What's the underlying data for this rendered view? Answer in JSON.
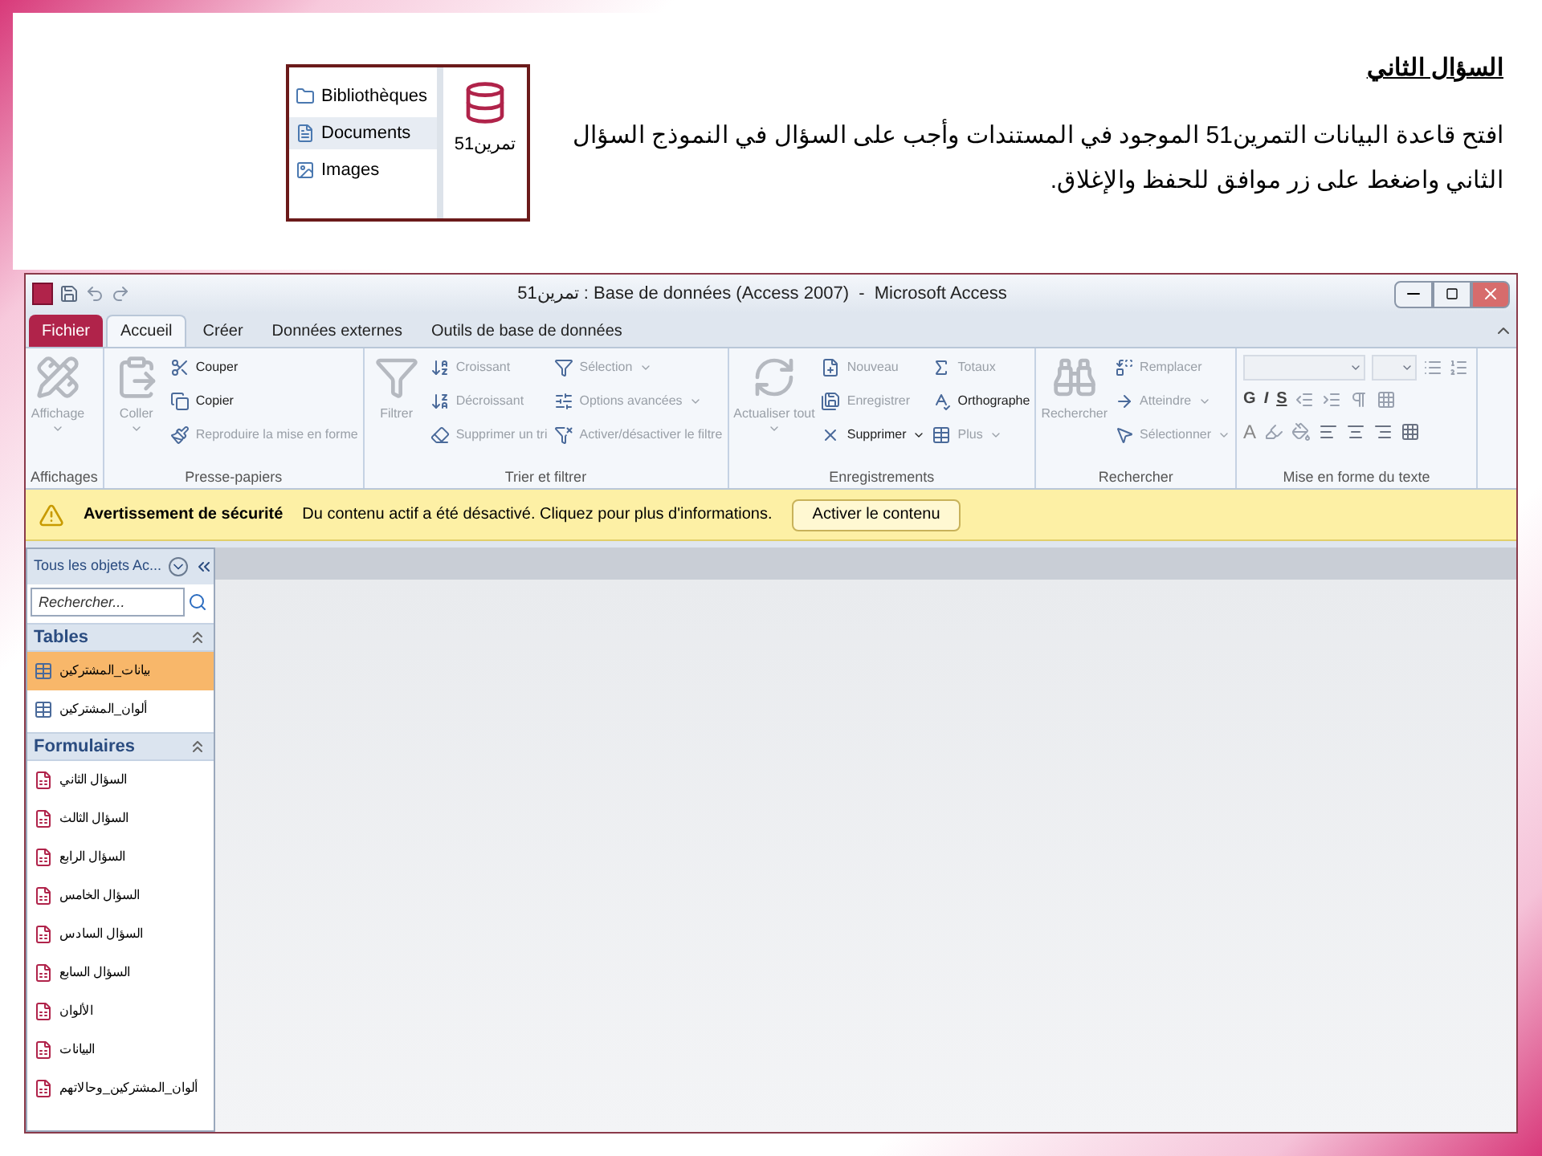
{
  "slide": {
    "heading": "السؤال الثاني",
    "instruction": "افتح قاعدة البيانات التمرين51 الموجود في  المستندات وأجب على السؤال في النموذج السؤال الثاني واضغط على زر موافق للحفظ والإغلاق.",
    "explorer": {
      "items": [
        {
          "label": "Bibliothèques",
          "kind": "library",
          "selected": false
        },
        {
          "label": "Documents",
          "kind": "document",
          "selected": true
        },
        {
          "label": "Images",
          "kind": "image",
          "selected": false
        }
      ],
      "file": "تمرين51"
    }
  },
  "window": {
    "title": "تمرين51 : Base de données (Access 2007)  -  Microsoft Access"
  },
  "tabs": [
    {
      "label": "Fichier",
      "kind": "file",
      "selected": false
    },
    {
      "label": "Accueil",
      "kind": "tab",
      "selected": true
    },
    {
      "label": "Créer",
      "kind": "tab",
      "selected": false
    },
    {
      "label": "Données externes",
      "kind": "tab",
      "selected": false
    },
    {
      "label": "Outils de base de données",
      "kind": "tab",
      "selected": false
    }
  ],
  "ribbon": {
    "groups": [
      {
        "label": "Affichages",
        "items": [
          {
            "label": "Affichage",
            "kind": "large",
            "disabled": true,
            "dropdown": true
          }
        ]
      },
      {
        "label": "Presse-papiers",
        "items": [
          {
            "label": "Coller",
            "kind": "large",
            "disabled": true,
            "dropdown": true
          },
          {
            "label": "Couper",
            "kind": "small",
            "disabled": false,
            "dropdown": false
          },
          {
            "label": "Copier",
            "kind": "small",
            "disabled": false,
            "dropdown": false
          },
          {
            "label": "Reproduire la mise en forme",
            "kind": "small",
            "disabled": true,
            "dropdown": false
          }
        ]
      },
      {
        "label": "Trier et filtrer",
        "items": [
          {
            "label": "Filtrer",
            "kind": "large",
            "disabled": true,
            "dropdown": false
          },
          {
            "label": "Croissant",
            "kind": "small",
            "disabled": true,
            "dropdown": false
          },
          {
            "label": "Décroissant",
            "kind": "small",
            "disabled": true,
            "dropdown": false
          },
          {
            "label": "Supprimer un tri",
            "kind": "small",
            "disabled": true,
            "dropdown": false
          },
          {
            "label": "Sélection",
            "kind": "small",
            "disabled": true,
            "dropdown": true
          },
          {
            "label": "Options avancées",
            "kind": "small",
            "disabled": true,
            "dropdown": true
          },
          {
            "label": "Activer/désactiver le filtre",
            "kind": "small",
            "disabled": true,
            "dropdown": false
          }
        ]
      },
      {
        "label": "Enregistrements",
        "items": [
          {
            "label": "Actualiser tout",
            "kind": "large",
            "disabled": true,
            "dropdown": true
          },
          {
            "label": "Nouveau",
            "kind": "small",
            "disabled": true,
            "dropdown": false
          },
          {
            "label": "Enregistrer",
            "kind": "small",
            "disabled": true,
            "dropdown": false
          },
          {
            "label": "Supprimer",
            "kind": "small",
            "disabled": false,
            "dropdown": true
          },
          {
            "label": "Totaux",
            "kind": "small",
            "disabled": true,
            "dropdown": false
          },
          {
            "label": "Orthographe",
            "kind": "small",
            "disabled": false,
            "dropdown": false
          },
          {
            "label": "Plus",
            "kind": "small",
            "disabled": true,
            "dropdown": true
          }
        ]
      },
      {
        "label": "Rechercher",
        "items": [
          {
            "label": "Rechercher",
            "kind": "large",
            "disabled": true,
            "dropdown": false
          },
          {
            "label": "Remplacer",
            "kind": "small",
            "disabled": true,
            "dropdown": false
          },
          {
            "label": "Atteindre",
            "kind": "small",
            "disabled": true,
            "dropdown": true
          },
          {
            "label": "Sélectionner",
            "kind": "small",
            "disabled": true,
            "dropdown": true
          }
        ]
      },
      {
        "label": "Mise en forme du texte",
        "kind": "font",
        "format_letters": [
          "G",
          "I",
          "S"
        ],
        "color_letter": "A"
      }
    ]
  },
  "security_bar": {
    "title": "Avertissement de sécurité",
    "message": "Du contenu actif a été désactivé. Cliquez pour plus d'informations.",
    "button": "Activer le contenu"
  },
  "nav_pane": {
    "title": "Tous les objets Ac...",
    "search": {
      "placeholder": "Rechercher..."
    },
    "sections": [
      {
        "label": "Tables",
        "kind": "table",
        "items": [
          {
            "label": "بيانات_المشتركين",
            "selected": true
          },
          {
            "label": "ألوان_المشتركين",
            "selected": false
          }
        ]
      },
      {
        "label": "Formulaires",
        "kind": "form",
        "items": [
          {
            "label": "السؤال الثاني",
            "selected": false
          },
          {
            "label": "السؤال الثالث",
            "selected": false
          },
          {
            "label": "السؤال الرابع",
            "selected": false
          },
          {
            "label": "السؤال الخامس",
            "selected": false
          },
          {
            "label": "السؤال السادس",
            "selected": false
          },
          {
            "label": "السؤال السابع",
            "selected": false
          },
          {
            "label": "الألوان",
            "selected": false
          },
          {
            "label": "البيانات",
            "selected": false
          },
          {
            "label": "ألوان_المشتركين_وحالاتهم",
            "selected": false
          }
        ]
      }
    ]
  }
}
